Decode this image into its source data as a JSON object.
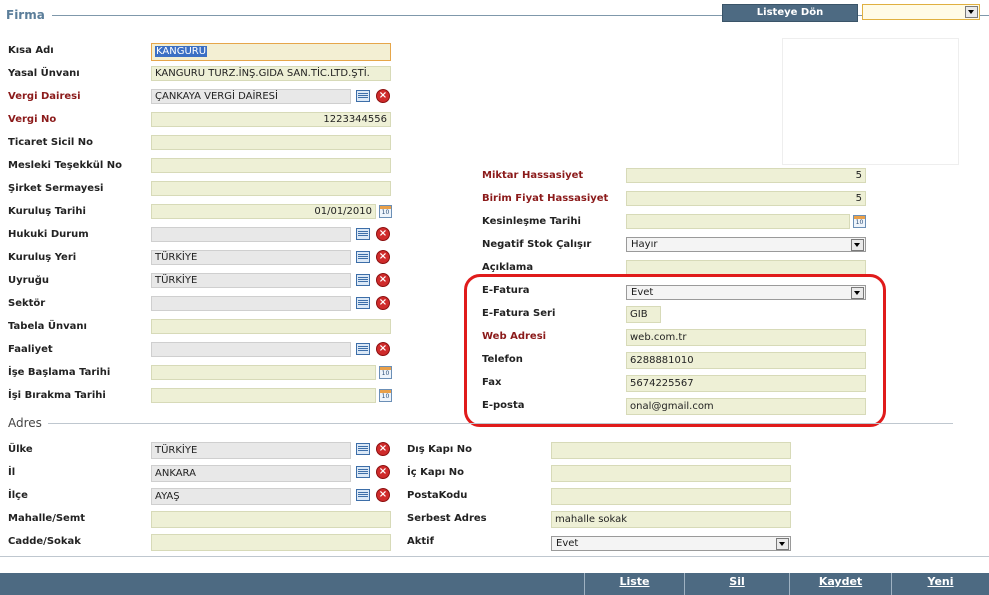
{
  "header": {
    "title": "Firma",
    "back_button": "Listeye Dön"
  },
  "firma": {
    "kisa_adi": {
      "label": "Kısa Adı",
      "value": "KANGURU"
    },
    "yasal_unvani": {
      "label": "Yasal Ünvanı",
      "value": "KANGURU TURZ.İNŞ.GIDA SAN.TİC.LTD.ŞTİ."
    },
    "vergi_dairesi": {
      "label": "Vergi Dairesi",
      "value": "ÇANKAYA VERGİ DAİRESİ"
    },
    "vergi_no": {
      "label": "Vergi No",
      "value": "1223344556"
    },
    "ticaret_sicil_no": {
      "label": "Ticaret Sicil No",
      "value": ""
    },
    "mesleki_teskil_no": {
      "label": "Mesleki Teşekkül No",
      "value": ""
    },
    "sirket_sermayesi": {
      "label": "Şirket Sermayesi",
      "value": ""
    },
    "kurulus_tarihi": {
      "label": "Kuruluş Tarihi",
      "value": "01/01/2010"
    },
    "hukuki_durum": {
      "label": "Hukuki Durum",
      "value": ""
    },
    "kurulus_yeri": {
      "label": "Kuruluş Yeri",
      "value": "TÜRKİYE"
    },
    "uyrugu": {
      "label": "Uyruğu",
      "value": "TÜRKİYE"
    },
    "sektor": {
      "label": "Sektör",
      "value": ""
    },
    "tabela_unvani": {
      "label": "Tabela Ünvanı",
      "value": ""
    },
    "faaliyet": {
      "label": "Faaliyet",
      "value": ""
    },
    "ise_baslama_tarihi": {
      "label": "İşe Başlama Tarihi",
      "value": ""
    },
    "isi_birakma_tarihi": {
      "label": "İşi Bırakma Tarihi",
      "value": ""
    }
  },
  "settings": {
    "miktar_hassasiyet": {
      "label": "Miktar Hassasiyet",
      "value": "5"
    },
    "birim_fiyat_hassasiyet": {
      "label": "Birim Fiyat Hassasiyet",
      "value": "5"
    },
    "kesinlesme_tarihi": {
      "label": "Kesinleşme Tarihi",
      "value": ""
    },
    "negatif_stok": {
      "label": "Negatif Stok Çalışır",
      "value": "Hayır"
    },
    "aciklama": {
      "label": "Açıklama",
      "value": ""
    },
    "e_fatura": {
      "label": "E-Fatura",
      "value": "Evet"
    },
    "e_fatura_seri": {
      "label": "E-Fatura Seri",
      "value": "GIB"
    },
    "web_adresi": {
      "label": "Web Adresi",
      "value": "web.com.tr"
    },
    "telefon": {
      "label": "Telefon",
      "value": "6288881010"
    },
    "fax": {
      "label": "Fax",
      "value": "5674225567"
    },
    "eposta": {
      "label": "E-posta",
      "value": "onal@gmail.com"
    }
  },
  "adres": {
    "title": "Adres",
    "ulke": {
      "label": "Ülke",
      "value": "TÜRKİYE"
    },
    "il": {
      "label": "İl",
      "value": "ANKARA"
    },
    "ilce": {
      "label": "İlçe",
      "value": "AYAŞ"
    },
    "mahalle": {
      "label": "Mahalle/Semt",
      "value": ""
    },
    "cadde": {
      "label": "Cadde/Sokak",
      "value": ""
    },
    "dis_kapi": {
      "label": "Dış Kapı No",
      "value": ""
    },
    "ic_kapi": {
      "label": "İç Kapı No",
      "value": ""
    },
    "posta_kodu": {
      "label": "PostaKodu",
      "value": ""
    },
    "serbest_adres": {
      "label": "Serbest Adres",
      "value": "mahalle sokak"
    },
    "aktif": {
      "label": "Aktif",
      "value": "Evet"
    }
  },
  "footer": {
    "liste": "Liste",
    "sil": "Sil",
    "kaydet": "Kaydet",
    "yeni": "Yeni"
  },
  "colors": {
    "accent": "#4d6a82",
    "highlight": "#e01b1b",
    "field_bg": "#eef0d6"
  },
  "icons": [
    "list-icon",
    "delete-icon",
    "calendar-icon",
    "dropdown-arrow-icon"
  ]
}
